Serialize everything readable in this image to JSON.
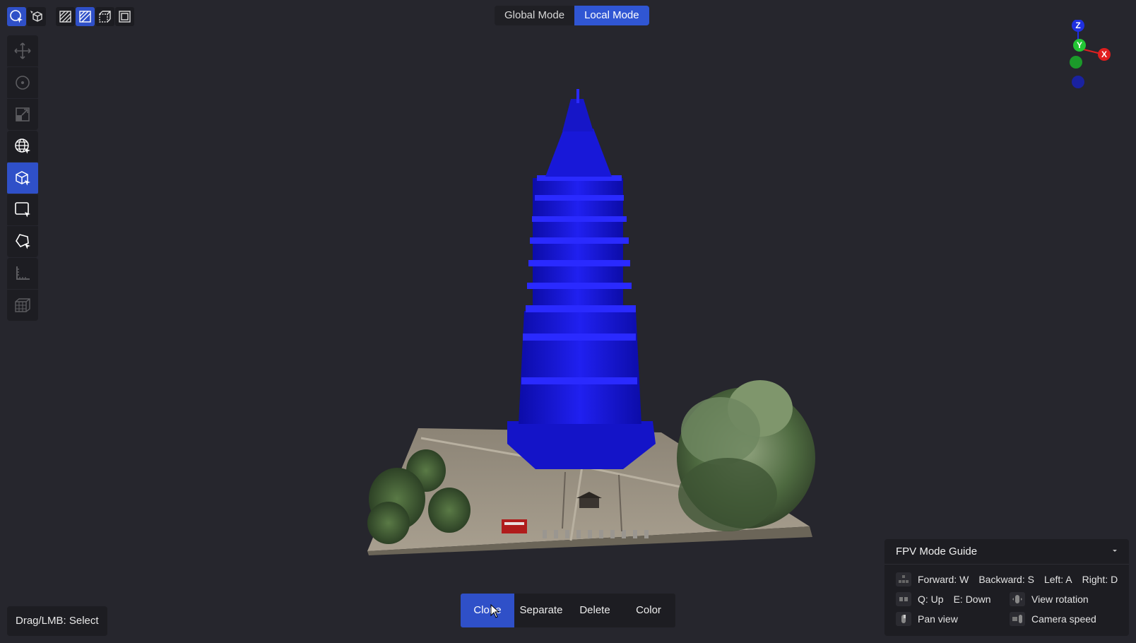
{
  "top_toolbar": {
    "group1": [
      {
        "icon": "select-rotate-icon",
        "active": true
      },
      {
        "icon": "cube-select-icon",
        "active": false
      }
    ],
    "group2": [
      {
        "icon": "hatch-fill-icon",
        "active": false
      },
      {
        "icon": "hatch-box-icon",
        "active": true
      },
      {
        "icon": "dashed-cube-icon",
        "active": false
      },
      {
        "icon": "frame-box-icon",
        "active": false
      }
    ]
  },
  "mode_switch": {
    "options": [
      "Global Mode",
      "Local Mode"
    ],
    "active": "Local Mode"
  },
  "left_toolbar": [
    {
      "icon": "move-icon",
      "state": "disabled"
    },
    {
      "icon": "rotate-icon",
      "state": "disabled"
    },
    {
      "icon": "scale-icon",
      "state": "disabled"
    },
    {
      "icon": "globe-select-icon",
      "state": "normal"
    },
    {
      "icon": "box-select-icon",
      "state": "active"
    },
    {
      "icon": "rect-select-icon",
      "state": "normal"
    },
    {
      "icon": "lasso-select-icon",
      "state": "normal"
    },
    {
      "icon": "measure-icon",
      "state": "disabled"
    },
    {
      "icon": "grid-box-icon",
      "state": "disabled"
    }
  ],
  "gizmo": {
    "labels": {
      "z": "Z",
      "y": "Y",
      "x": "X"
    }
  },
  "status": {
    "text": "Drag/LMB: Select"
  },
  "action_bar": {
    "buttons": [
      "Clone",
      "Separate",
      "Delete",
      "Color"
    ],
    "active": "Clone"
  },
  "fpv_guide": {
    "title": "FPV Mode Guide",
    "rows": [
      {
        "icon": "wasd-keys-icon",
        "items": [
          "Forward: W",
          "Backward: S",
          "Left: A",
          "Right: D"
        ]
      },
      {
        "icon": "qe-keys-icon",
        "items": [
          "Q: Up",
          "E: Down"
        ]
      },
      {
        "icon": "mouse-drag-icon",
        "items": [
          "View rotation"
        ]
      },
      {
        "icon": "mouse-right-icon",
        "items": [
          "Pan view"
        ]
      },
      {
        "icon": "ctrl-scroll-icon",
        "items": [
          "Camera speed"
        ]
      }
    ]
  },
  "colors": {
    "background": "#26262d",
    "panel": "#1d1d22",
    "accent": "#2f50c8",
    "selection": "#1a1aff"
  }
}
